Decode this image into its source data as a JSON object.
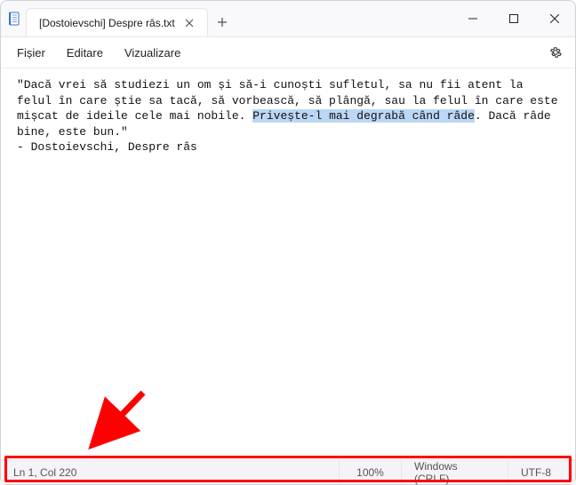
{
  "titlebar": {
    "tab_title": "[Dostoievschi] Despre râs.txt"
  },
  "menubar": {
    "file": "Fișier",
    "edit": "Editare",
    "view": "Vizualizare"
  },
  "document": {
    "before_selection": "\"Dacă vrei să studiezi un om și să-i cunoști sufletul, sa nu fii atent la felul în care știe sa tacă, să vorbească, să plângă, sau la felul în care este mișcat de ideile cele mai nobile. ",
    "selection": "Privește-l mai degrabă când râde",
    "after_selection": ". Dacă râde bine, este bun.\"\n- Dostoievschi, Despre râs"
  },
  "statusbar": {
    "position": "Ln 1, Col 220",
    "zoom": "100%",
    "line_ending": "Windows (CRLF)",
    "encoding": "UTF-8"
  }
}
